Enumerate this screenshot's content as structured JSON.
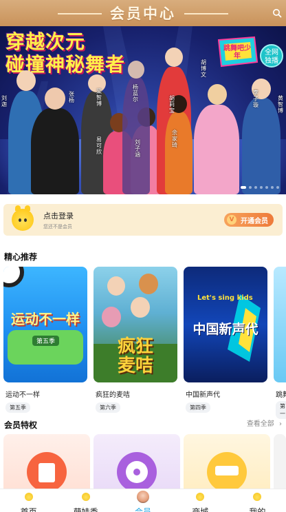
{
  "header": {
    "title": "会员中心",
    "search_icon": "search-icon"
  },
  "banner": {
    "headline_line1": "穿越次元",
    "headline_line2": "碰撞神秘舞者",
    "show_logo_text": "跳舞吧少年",
    "vip_badge_line1": "全网",
    "vip_badge_line2": "独播",
    "cast": [
      "刘迦",
      "张杨",
      "梁智博",
      "杨蓝尔",
      "胡博文",
      "胡莉宝",
      "李子璇",
      "黄智博",
      "易可欣",
      "刘子涵",
      "余家琦",
      "黄子韬"
    ],
    "carousel_count": 7,
    "carousel_active": 1
  },
  "login": {
    "title": "点击登录",
    "subtitle": "您还不是会员",
    "open_vip_label": "开通会员",
    "open_vip_icon": "V"
  },
  "recommend": {
    "title": "精心推荐",
    "shows": [
      {
        "name": "运动不一样",
        "season": "第五季",
        "poster_text": "运动不一样",
        "poster_sub": "第五季"
      },
      {
        "name": "疯狂的麦咭",
        "season": "第六季",
        "poster_text": "疯狂麦咭"
      },
      {
        "name": "中国新声代",
        "season": "第四季",
        "poster_text": "中国新声代",
        "poster_sub": "Let's sing kids"
      },
      {
        "name": "跳舞",
        "season": "第一"
      }
    ]
  },
  "privileges": {
    "title": "会员特权",
    "see_all": "查看全部",
    "see_all_icon": "chevron-right-icon"
  },
  "nav": [
    {
      "label": "首页",
      "icon": "home-mascot-icon",
      "active": false
    },
    {
      "label": "萌娃秀",
      "icon": "kids-show-icon",
      "active": false
    },
    {
      "label": "会员",
      "icon": "member-avatar-icon",
      "active": true
    },
    {
      "label": "商城",
      "icon": "mall-icon",
      "active": false
    },
    {
      "label": "我的",
      "icon": "profile-icon",
      "active": false
    }
  ],
  "colors": {
    "header_gold": "#c9925a",
    "login_bg": "#fbeed2",
    "vip_orange": "#ee7a3a",
    "nav_active": "#21a8e6"
  }
}
